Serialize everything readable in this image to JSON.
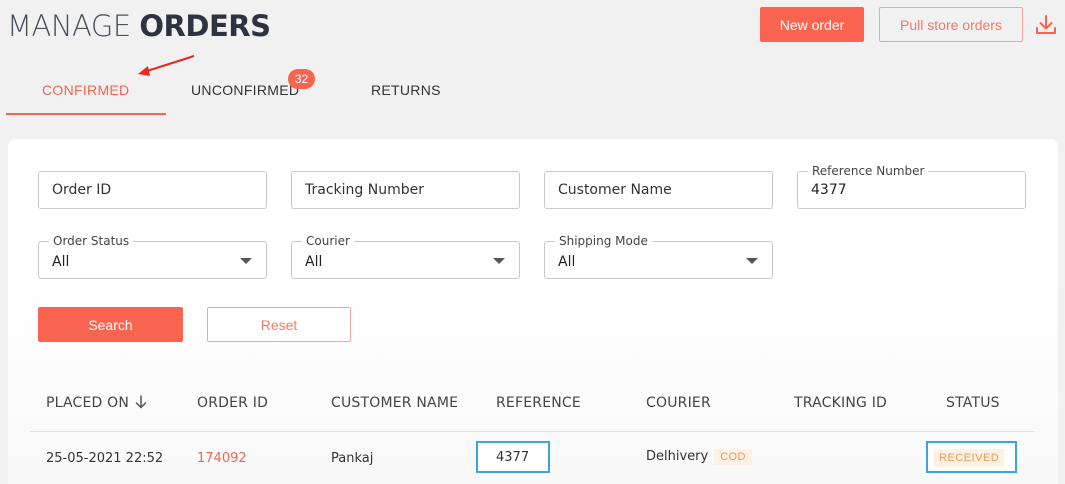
{
  "header": {
    "title_light": "MANAGE",
    "title_bold": "ORDERS",
    "new_order_label": "New order",
    "pull_store_label": "Pull store orders",
    "download_icon": "download-icon"
  },
  "tabs": [
    {
      "label": "CONFIRMED",
      "active": true
    },
    {
      "label": "UNCONFIRMED",
      "badge": "32"
    },
    {
      "label": "RETURNS"
    }
  ],
  "colors": {
    "accent": "#f96451",
    "highlight_border": "#3aa3e3",
    "badge_bg": "#fdf1e6",
    "badge_text": "#f09a4a"
  },
  "filters": {
    "order_id": {
      "placeholder": "Order ID"
    },
    "tracking_number": {
      "placeholder": "Tracking Number"
    },
    "customer_name": {
      "placeholder": "Customer Name"
    },
    "reference_number": {
      "label": "Reference Number",
      "value": "4377"
    },
    "order_status": {
      "label": "Order Status",
      "value": "All"
    },
    "courier": {
      "label": "Courier",
      "value": "All"
    },
    "shipping_mode": {
      "label": "Shipping Mode",
      "value": "All"
    },
    "search_label": "Search",
    "reset_label": "Reset"
  },
  "table": {
    "columns": [
      "PLACED ON",
      "ORDER ID",
      "CUSTOMER NAME",
      "REFERENCE",
      "COURIER",
      "TRACKING ID",
      "STATUS"
    ],
    "rows": [
      {
        "placed_on": "25-05-2021 22:52",
        "order_id": "174092",
        "customer_name": "Pankaj",
        "reference": "4377",
        "courier": "Delhivery",
        "payment_mode": "COD",
        "tracking_id": "",
        "status": "RECEIVED"
      }
    ]
  }
}
